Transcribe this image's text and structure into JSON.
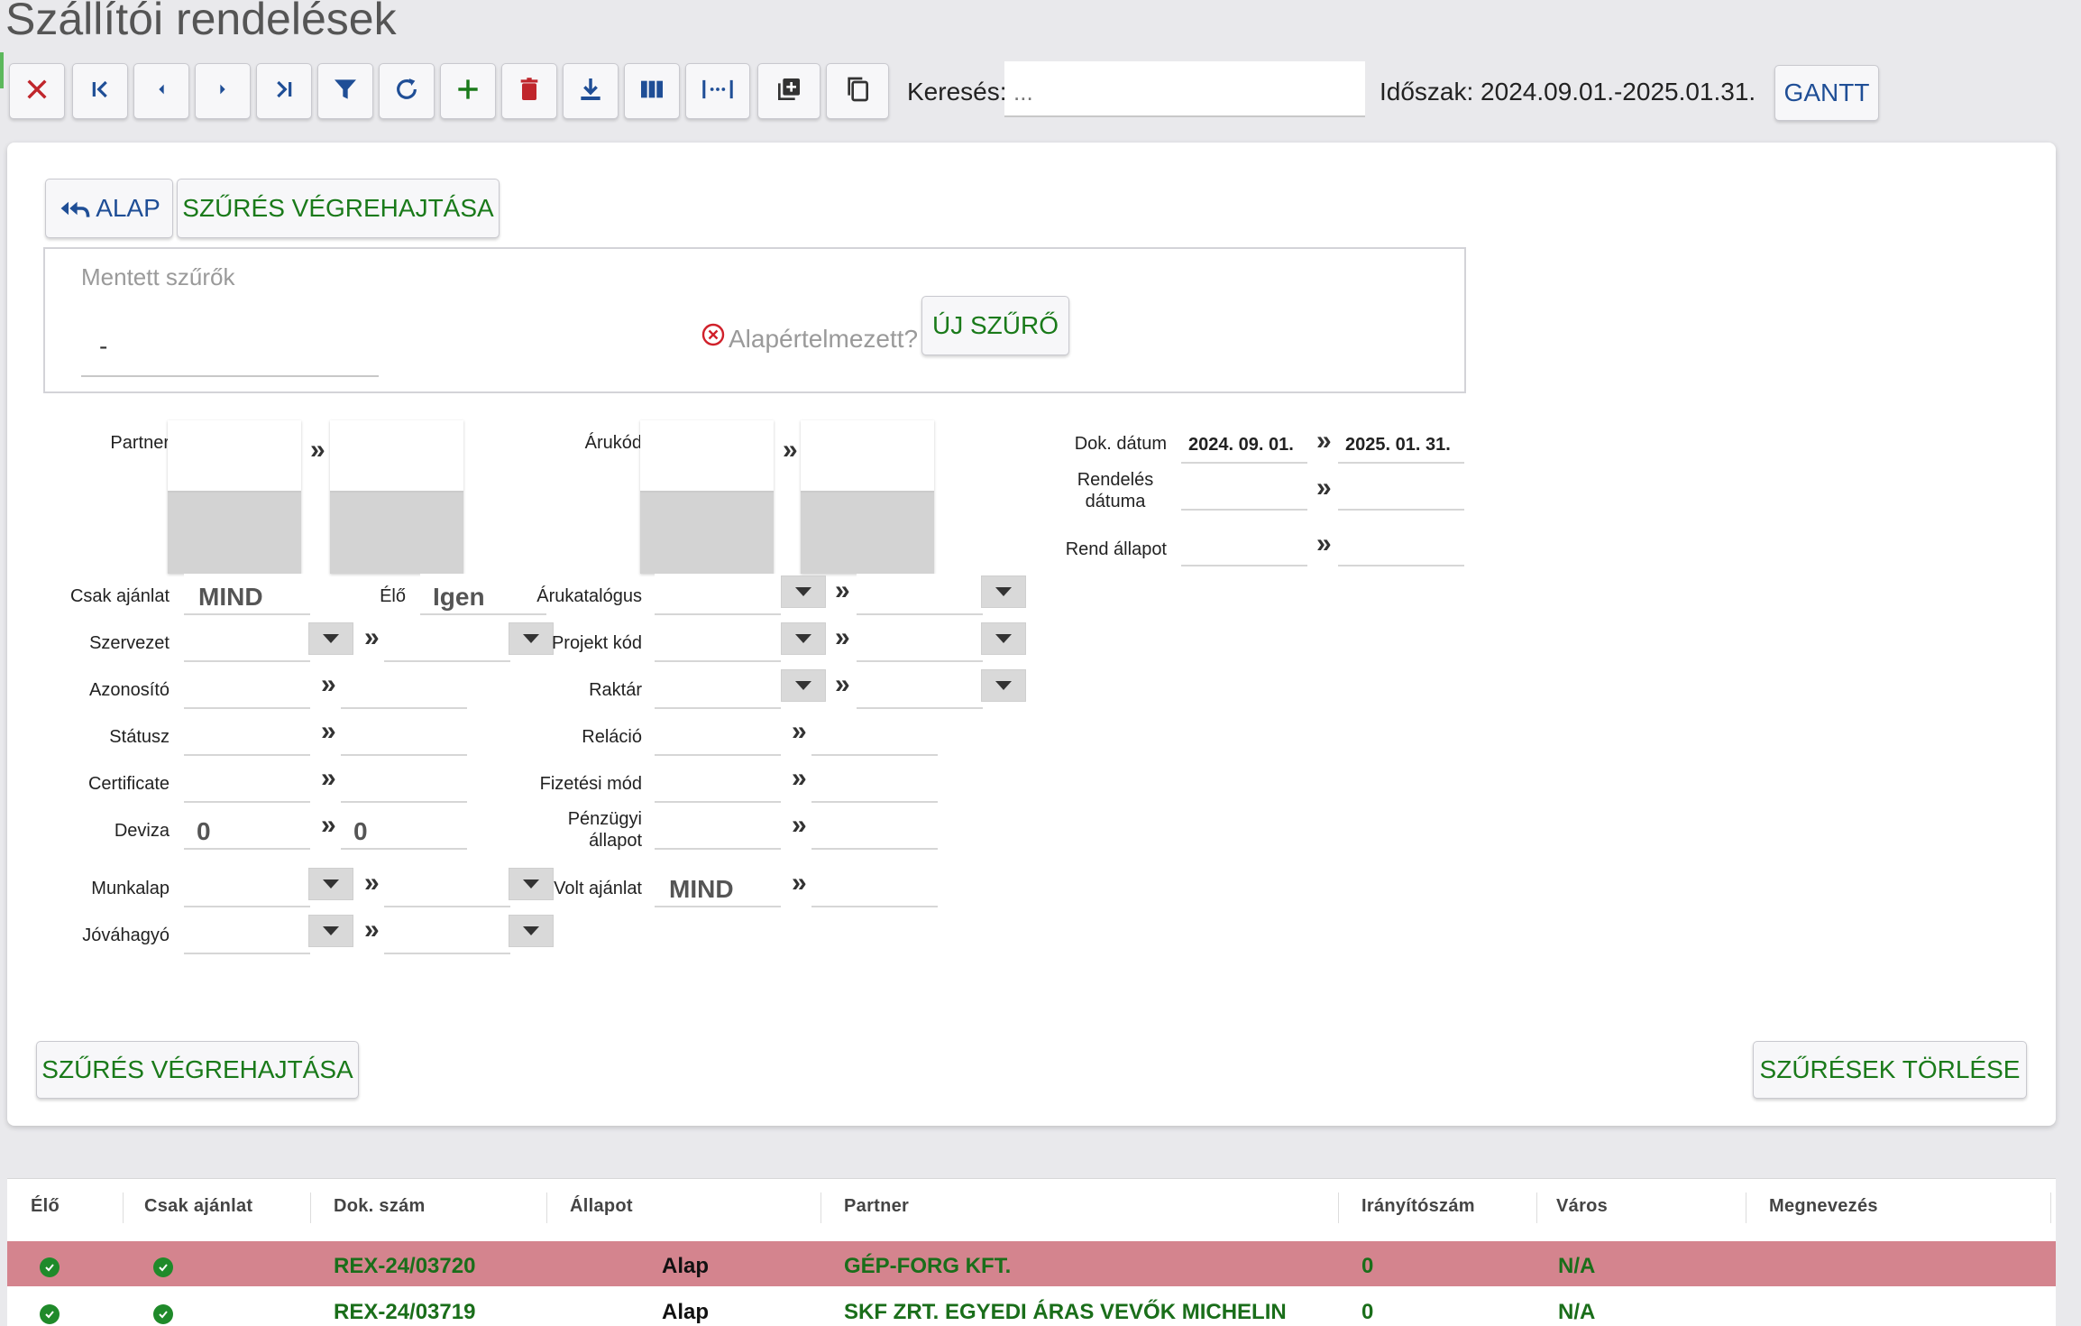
{
  "page": {
    "title": "Szállítói rendelések"
  },
  "toolbar": {
    "buttons": [
      "close-icon",
      "first-page-icon",
      "prev-icon",
      "next-icon",
      "last-page-icon",
      "filter-icon",
      "refresh-icon",
      "add-icon",
      "delete-icon",
      "download-icon",
      "columns-icon",
      "spacing-icon",
      "add-copy-icon",
      "copy-icon"
    ],
    "search_label": "Keresés:",
    "search_placeholder": "...",
    "period": "Időszak: 2024.09.01.-2025.01.31.",
    "gantt": "GANTT"
  },
  "filter": {
    "back_label": "ALAP",
    "run_label": "SZŰRÉS VÉGREHAJTÁSA",
    "saved_label": "Mentett szűrők",
    "saved_value": "-",
    "default_label": "Alapértelmezett?",
    "new_filter": "ÚJ SZŰRŐ",
    "labels": {
      "partner": "Partner",
      "arukod": "Árukód",
      "dok_datum": "Dok. dátum",
      "rendeles_datuma": "Rendelés dátuma",
      "rend_allapot": "Rend állapot",
      "csak_ajanlat": "Csak ajánlat",
      "elo": "Élő",
      "arukatalogus": "Árukatalógus",
      "szervezet": "Szervezet",
      "projekt_kod": "Projekt kód",
      "azonosito": "Azonosító",
      "raktar": "Raktár",
      "statusz": "Státusz",
      "relacio": "Reláció",
      "certificate": "Certificate",
      "fizetesi_mod": "Fizetési mód",
      "deviza": "Deviza",
      "penzugyi_allapot": "Pénzügyi állapot",
      "munkalap": "Munkalap",
      "volt_ajanlat": "Volt ajánlat",
      "jovahagyo": "Jóváhagyó"
    },
    "values": {
      "dok_datum_from": "2024. 09. 01.",
      "dok_datum_to": "2025. 01. 31.",
      "csak_ajanlat": "MIND",
      "elo": "Igen",
      "deviza_from": "0",
      "deviza_to": "0",
      "volt_ajanlat": "MIND"
    },
    "range_arrow": "»",
    "bottom_run": "SZŰRÉS VÉGREHAJTÁSA",
    "clear": "SZŰRÉSEK TÖRLÉSE"
  },
  "table": {
    "headers": [
      "Élő",
      "Csak ajánlat",
      "Dok. szám",
      "Állapot",
      "Partner",
      "Irányítószám",
      "Város",
      "Megnevezés"
    ],
    "rows": [
      {
        "dok_szam": "REX-24/03720",
        "allapot": "Alap",
        "partner": "GÉP-FORG KFT.",
        "irsz": "0",
        "varos": "N/A",
        "highlight": true
      },
      {
        "dok_szam": "REX-24/03719",
        "allapot": "Alap",
        "partner": "SKF ZRT. EGYEDI ÁRAS VEVŐK MICHELIN",
        "irsz": "0",
        "varos": "N/A",
        "highlight": false
      }
    ]
  },
  "colors": {
    "accent_green": "#1a7a1a",
    "accent_blue": "#1f4e96",
    "row_highlight": "#d4848e",
    "delete_red": "#c0262c"
  }
}
